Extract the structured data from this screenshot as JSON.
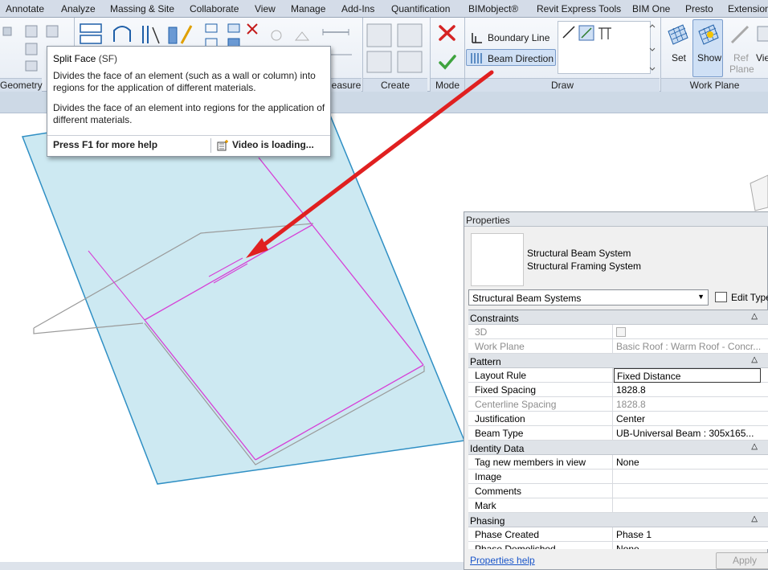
{
  "ribbon": {
    "tabs": [
      "Annotate",
      "Analyze",
      "Massing & Site",
      "Collaborate",
      "View",
      "Manage",
      "Add-Ins",
      "Quantification",
      "BIMobject®",
      "Revit Express Tools",
      "BIM One",
      "Presto",
      "Extension"
    ],
    "panels": {
      "geometry": "Geometry",
      "measure": "easure",
      "create": "Create",
      "mode": "Mode",
      "draw": "Draw",
      "work_plane": "Work Plane"
    },
    "draw": {
      "boundary_line": "Boundary Line",
      "beam_direction": "Beam Direction"
    },
    "work_plane": {
      "set": "Set",
      "show": "Show",
      "ref_plane_1": "Ref",
      "ref_plane_2": "Plane",
      "viewer": "Vie"
    }
  },
  "tooltip": {
    "title": "Split Face",
    "shortcut": "(SF)",
    "desc1": "Divides the face of an element (such as a wall or column) into regions for the application of different materials.",
    "desc2": "Divides the face of an element into regions for the application of different materials.",
    "help": "Press F1 for more help",
    "video": "Video is loading..."
  },
  "properties": {
    "title": "Properties",
    "type_line1": "Structural Beam System",
    "type_line2": "Structural Framing System",
    "type_selector": "Structural Beam Systems",
    "edit_type": "Edit Type",
    "groups": {
      "constraints": "Constraints",
      "pattern": "Pattern",
      "identity": "Identity Data",
      "phasing": "Phasing"
    },
    "rows": {
      "three_d": {
        "k": "3D",
        "v": ""
      },
      "work_plane": {
        "k": "Work Plane",
        "v": "Basic Roof : Warm Roof - Concr..."
      },
      "layout_rule": {
        "k": "Layout Rule",
        "v": "Fixed Distance"
      },
      "fixed_spacing": {
        "k": "Fixed Spacing",
        "v": "1828.8"
      },
      "centerline_spacing": {
        "k": "Centerline Spacing",
        "v": "1828.8"
      },
      "justification": {
        "k": "Justification",
        "v": "Center"
      },
      "beam_type": {
        "k": "Beam Type",
        "v": "UB-Universal Beam : 305x165..."
      },
      "tag_new": {
        "k": "Tag new members in view",
        "v": "None"
      },
      "image": {
        "k": "Image",
        "v": ""
      },
      "comments": {
        "k": "Comments",
        "v": ""
      },
      "mark": {
        "k": "Mark",
        "v": ""
      },
      "phase_created": {
        "k": "Phase Created",
        "v": "Phase 1"
      },
      "phase_demolished": {
        "k": "Phase Demolished",
        "v": "None"
      }
    },
    "help_link": "Properties help",
    "apply": "Apply"
  },
  "colors": {
    "plane_fill": "#cde9f2",
    "plane_edge": "#2f8fc4",
    "sketch_line": "#d63fd6",
    "arrow": "#e02020"
  }
}
